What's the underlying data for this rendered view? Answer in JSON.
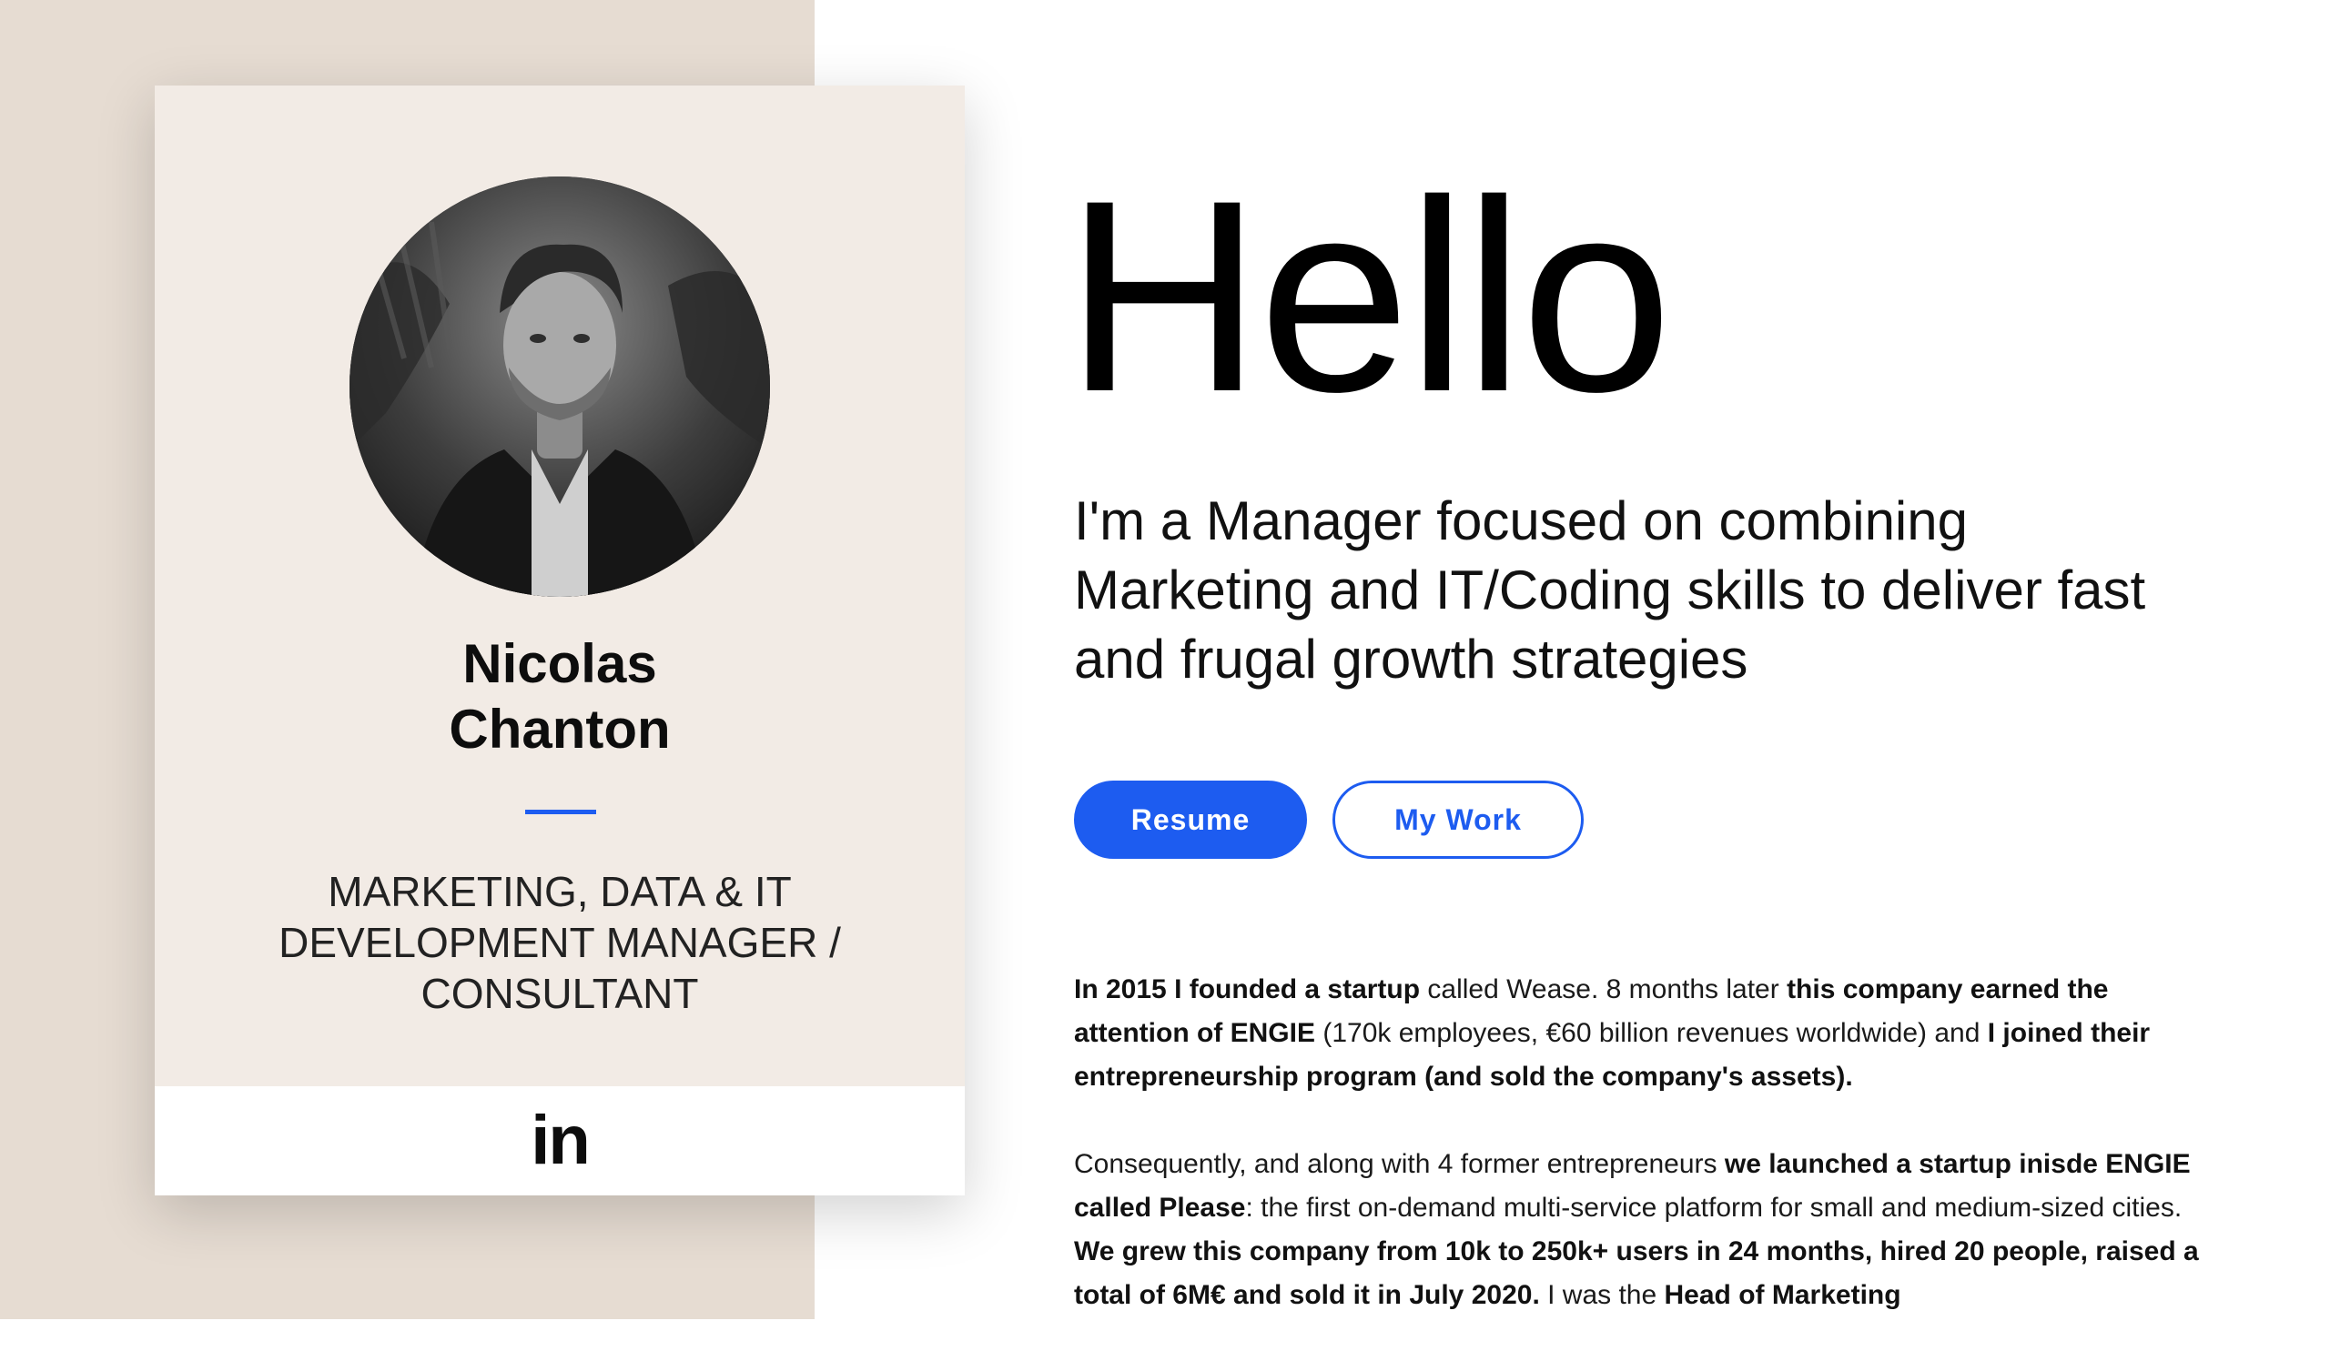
{
  "profile": {
    "name_first": "Nicolas",
    "name_last": "Chanton",
    "role": "MARKETING, DATA & IT DEVELOPMENT MANAGER / CONSULTANT",
    "linkedin_label": "in"
  },
  "main": {
    "heading": "Hello",
    "tagline": "I'm a Manager focused on combining Marketing and IT/Coding skills to deliver fast and frugal growth strategies",
    "buttons": {
      "resume": "Resume",
      "my_work": "My Work"
    },
    "bio": {
      "p1": [
        {
          "t": "In 2015 I founded a startup",
          "b": true
        },
        {
          "t": " called Wease. 8 months later ",
          "b": false
        },
        {
          "t": "this company earned the attention of ENGIE",
          "b": true
        },
        {
          "t": " (170k employees, €60 billion revenues worldwide) and ",
          "b": false
        },
        {
          "t": "I joined their entrepreneurship program (and sold the company's assets).",
          "b": true
        }
      ],
      "p2": [
        {
          "t": "Consequently, and along with 4 former entrepreneurs ",
          "b": false
        },
        {
          "t": "we launched a startup inisde ENGIE called Please",
          "b": true
        },
        {
          "t": ": the first on-demand multi-service platform for small and medium-sized cities. ",
          "b": false
        },
        {
          "t": "We grew this company from 10k to 250k+ users in 24 months, hired 20 people, raised a total of 6M€ and sold it in July 2020.",
          "b": true
        },
        {
          "t": " I was the ",
          "b": false
        },
        {
          "t": "Head of Marketing",
          "b": true
        }
      ]
    }
  },
  "colors": {
    "accent": "#1d5cf0",
    "left_band": "#e6dcd2",
    "card_bg": "#f2ebe5"
  }
}
